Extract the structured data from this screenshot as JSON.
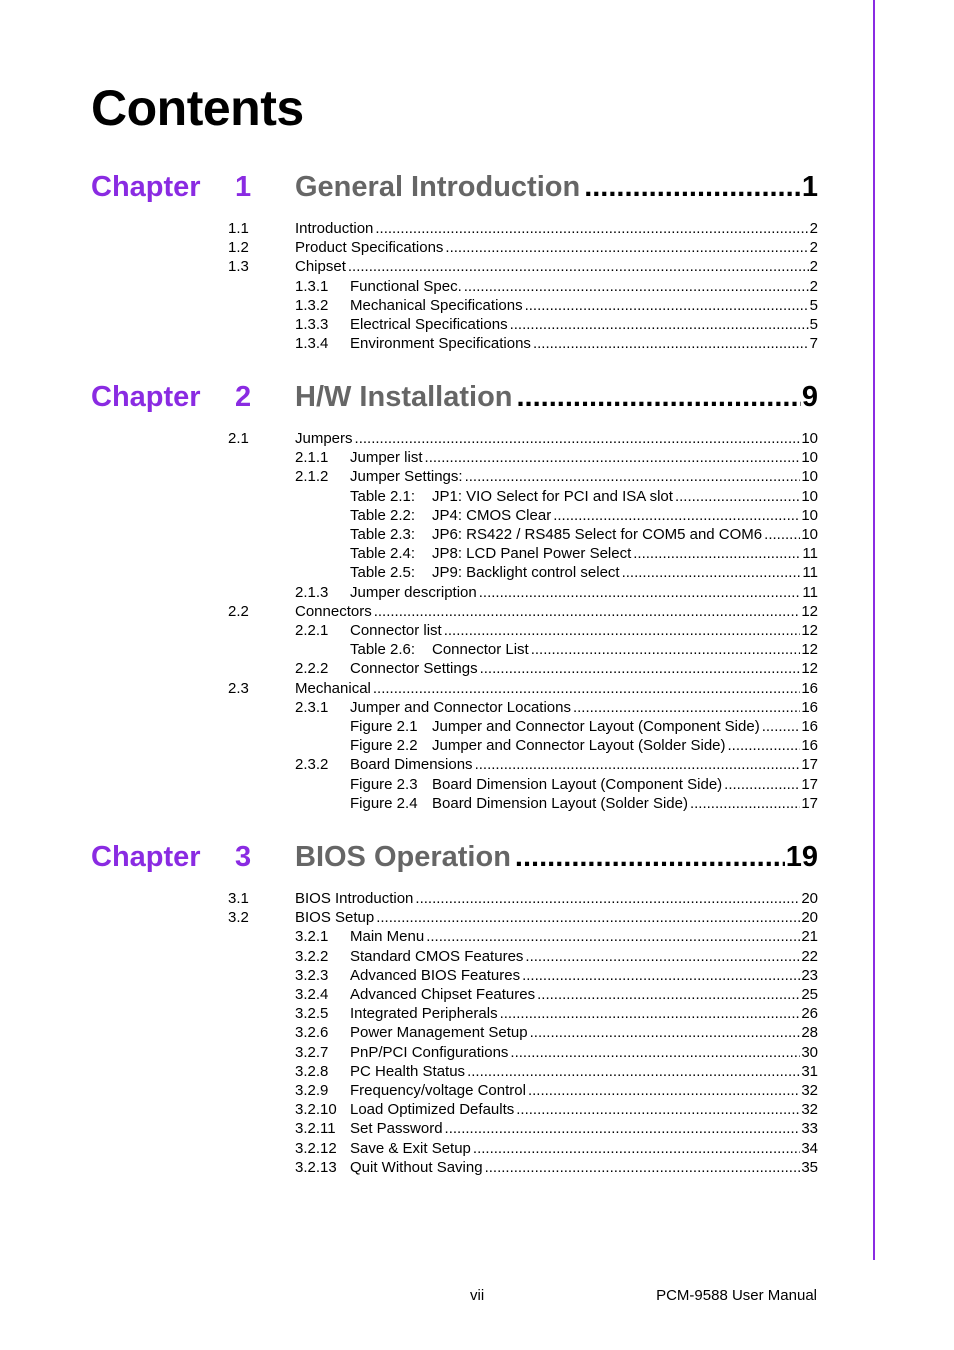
{
  "page_title": "Contents",
  "chapters": [
    {
      "word": "Chapter",
      "number": "1",
      "title": "General Introduction",
      "page": "1",
      "entries": [
        {
          "level": 1,
          "num": "1.1",
          "label": "Introduction",
          "page": "2"
        },
        {
          "level": 1,
          "num": "1.2",
          "label": "Product Specifications",
          "page": "2"
        },
        {
          "level": 1,
          "num": "1.3",
          "label": "Chipset",
          "page": "2"
        },
        {
          "level": 2,
          "num": "1.3.1",
          "label": "Functional Spec.",
          "page": "2"
        },
        {
          "level": 2,
          "num": "1.3.2",
          "label": "Mechanical Specifications",
          "page": "5"
        },
        {
          "level": 2,
          "num": "1.3.3",
          "label": "Electrical Specifications",
          "page": "5"
        },
        {
          "level": 2,
          "num": "1.3.4",
          "label": "Environment Specifications",
          "page": "7"
        }
      ]
    },
    {
      "word": "Chapter",
      "number": "2",
      "title": "H/W Installation",
      "page": "9",
      "entries": [
        {
          "level": 1,
          "num": "2.1",
          "label": "Jumpers",
          "page": "10"
        },
        {
          "level": 2,
          "num": "2.1.1",
          "label": "Jumper list",
          "page": "10"
        },
        {
          "level": 2,
          "num": "2.1.2",
          "label": "Jumper Settings:",
          "page": "10"
        },
        {
          "level": 3,
          "caption": "Table 2.1:",
          "label": "JP1: VIO Select for PCI and ISA slot",
          "page": "10"
        },
        {
          "level": 3,
          "caption": "Table 2.2:",
          "label": "JP4: CMOS Clear",
          "page": "10"
        },
        {
          "level": 3,
          "caption": "Table 2.3:",
          "label": "JP6: RS422 / RS485 Select for COM5 and COM6",
          "page": "10"
        },
        {
          "level": 3,
          "caption": "Table 2.4:",
          "label": "JP8: LCD Panel Power Select",
          "page": "11"
        },
        {
          "level": 3,
          "caption": "Table 2.5:",
          "label": "JP9: Backlight control select",
          "page": "11"
        },
        {
          "level": 2,
          "num": "2.1.3",
          "label": "Jumper description",
          "page": "11"
        },
        {
          "level": 1,
          "num": "2.2",
          "label": "Connectors",
          "page": "12"
        },
        {
          "level": 2,
          "num": "2.2.1",
          "label": "Connector list",
          "page": "12"
        },
        {
          "level": 3,
          "caption": "Table 2.6:",
          "label": "Connector List",
          "page": "12"
        },
        {
          "level": 2,
          "num": "2.2.2",
          "label": "Connector Settings",
          "page": "12"
        },
        {
          "level": 1,
          "num": "2.3",
          "label": "Mechanical",
          "page": "16"
        },
        {
          "level": 2,
          "num": "2.3.1",
          "label": "Jumper and Connector Locations",
          "page": "16"
        },
        {
          "level": 3,
          "caption": "Figure 2.1",
          "label": "Jumper and Connector Layout (Component Side)",
          "page": "16"
        },
        {
          "level": 3,
          "caption": "Figure 2.2",
          "label": "Jumper and Connector Layout (Solder Side)",
          "page": "16"
        },
        {
          "level": 2,
          "num": "2.3.2",
          "label": "Board Dimensions",
          "page": "17"
        },
        {
          "level": 3,
          "caption": "Figure 2.3",
          "label": "Board Dimension Layout (Component Side)",
          "page": "17"
        },
        {
          "level": 3,
          "caption": "Figure 2.4",
          "label": "Board Dimension Layout (Solder Side)",
          "page": "17"
        }
      ]
    },
    {
      "word": "Chapter",
      "number": "3",
      "title": "BIOS Operation",
      "page": "19",
      "entries": [
        {
          "level": 1,
          "num": "3.1",
          "label": "BIOS Introduction",
          "page": "20"
        },
        {
          "level": 1,
          "num": "3.2",
          "label": "BIOS Setup",
          "page": "20"
        },
        {
          "level": 2,
          "num": "3.2.1",
          "label": "Main Menu",
          "page": "21"
        },
        {
          "level": 2,
          "num": "3.2.2",
          "label": "Standard CMOS Features",
          "page": "22"
        },
        {
          "level": 2,
          "num": "3.2.3",
          "label": "Advanced BIOS Features",
          "page": "23"
        },
        {
          "level": 2,
          "num": "3.2.4",
          "label": "Advanced Chipset Features",
          "page": "25"
        },
        {
          "level": 2,
          "num": "3.2.5",
          "label": "Integrated Peripherals",
          "page": "26"
        },
        {
          "level": 2,
          "num": "3.2.6",
          "label": "Power Management Setup",
          "page": "28"
        },
        {
          "level": 2,
          "num": "3.2.7",
          "label": "PnP/PCI Configurations",
          "page": "30"
        },
        {
          "level": 2,
          "num": "3.2.8",
          "label": "PC Health Status",
          "page": "31"
        },
        {
          "level": 2,
          "num": "3.2.9",
          "label": "Frequency/voltage Control",
          "page": "32"
        },
        {
          "level": 2,
          "num": "3.2.10",
          "label": "Load Optimized Defaults",
          "page": "32"
        },
        {
          "level": 2,
          "num": "3.2.11",
          "label": "Set Password",
          "page": "33"
        },
        {
          "level": 2,
          "num": "3.2.12",
          "label": "Save & Exit Setup",
          "page": "34"
        },
        {
          "level": 2,
          "num": "3.2.13",
          "label": "Quit Without Saving",
          "page": "35"
        }
      ]
    }
  ],
  "footer": {
    "page_number": "vii",
    "manual_name": "PCM-9588 User Manual"
  },
  "colors": {
    "accent": "#8a2be2",
    "chapter_title": "#666666",
    "text": "#000000"
  }
}
